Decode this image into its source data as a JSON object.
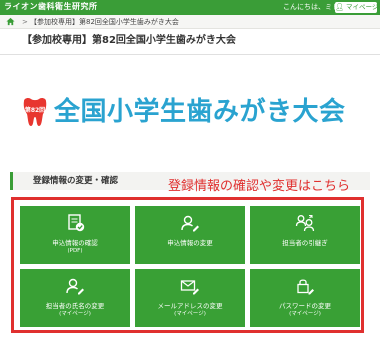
{
  "header": {
    "brand": "ライオン歯科衛生研究所",
    "greeting": "こんにちは、ミドリさん",
    "mypage_button": "マイページ"
  },
  "breadcrumb": {
    "separator": ">",
    "current": "【参加校専用】第82回全国小学生歯みがき大会"
  },
  "page_title": "【参加校専用】第82回全国小学生歯みがき大会",
  "event": {
    "badge": "第82回",
    "title": "全国小学生歯みがき大会"
  },
  "section": {
    "heading": "登録情報の変更・確認",
    "callout": "登録情報の確認や変更はこちら"
  },
  "tiles": [
    {
      "label": "申込情報の確認",
      "sub": "(PDF)",
      "icon": "document-check-icon"
    },
    {
      "label": "申込情報の変更",
      "sub": "",
      "icon": "person-edit-icon"
    },
    {
      "label": "担当者の引継ぎ",
      "sub": "",
      "icon": "people-transfer-icon"
    },
    {
      "label": "担当者の氏名の変更",
      "sub": "(マイページ)",
      "icon": "person-edit-icon"
    },
    {
      "label": "メールアドレスの変更",
      "sub": "(マイページ)",
      "icon": "mail-edit-icon"
    },
    {
      "label": "パスワードの変更",
      "sub": "(マイページ)",
      "icon": "lock-edit-icon"
    }
  ],
  "colors": {
    "brand_green": "#3a9d37",
    "tile_green": "#39a035",
    "accent_red": "#e0302f",
    "title_blue": "#2aa3d0"
  }
}
